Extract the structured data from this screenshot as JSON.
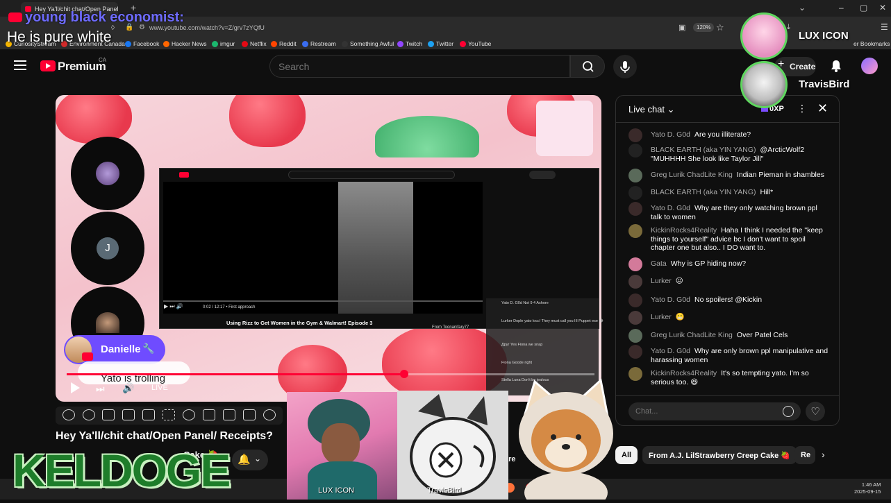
{
  "browser": {
    "tab_title": "Hey Ya'll/chit chat/Open Panel/",
    "url": "www.youtube.com/watch?v=Z/grv7zYQfU",
    "zoom": "120%",
    "bookmarks": [
      {
        "label": "CuriosityStream",
        "color": "#f5b500"
      },
      {
        "label": "Environment Canada",
        "color": "#d12a2a"
      },
      {
        "label": "Facebook",
        "color": "#1877f2"
      },
      {
        "label": "Hacker News",
        "color": "#ff6600"
      },
      {
        "label": "imgur",
        "color": "#1bb76e"
      },
      {
        "label": "Netflix",
        "color": "#e50914"
      },
      {
        "label": "Reddit",
        "color": "#ff4500"
      },
      {
        "label": "Restream",
        "color": "#3a6df0"
      },
      {
        "label": "Something Awful",
        "color": "#333333"
      },
      {
        "label": "Twitch",
        "color": "#9146ff"
      },
      {
        "label": "Twitter",
        "color": "#1da1f2"
      },
      {
        "label": "YouTube",
        "color": "#ff0033"
      }
    ],
    "other_bookmarks": "er Bookmarks"
  },
  "overlay": {
    "chat_author": "young black economist:",
    "chat_message": "He is pure white"
  },
  "header": {
    "brand": "Premium",
    "region": "CA",
    "search_placeholder": "Search",
    "create_label": "Create"
  },
  "video": {
    "inner_title": "Using Rizz to Get Women in the Gym & Walmart! Episode 3",
    "inner_time": "0:02 / 12:17 • First approach",
    "danielle": "Danielle",
    "trolling": "Yato is trolling",
    "live": "LIVE",
    "progress": 0.64,
    "title": "Hey Ya'll/chit chat/Open Panel/ Receipts?",
    "title_fragment": "Cake 🍓",
    "circle_initial": "J",
    "inner_chat": [
      "Yato D. G0d  Not 9 4 Ashore",
      "Lurker  Dople yato locc! They must call you III Puppet ese 😂",
      "Друг  Yes Fiona we snap",
      "Fiona Goode  right",
      "Stella Luna  Don't be jealous"
    ],
    "inner_from": "From Toonanifary77"
  },
  "chat": {
    "title": "Live chat",
    "xp": "0XP",
    "input_placeholder": "Chat...",
    "messages": [
      {
        "author": "Yato D. G0d",
        "text": "Are you illiterate?",
        "color": "#3a2a2a"
      },
      {
        "author": "BLACK EARTH (aka YIN YANG)",
        "text": "@ArcticWolf2 \"MUHHHH She look like Taylor Jill\"",
        "color": "#222"
      },
      {
        "author": "Greg Lurik ChadLite King",
        "text": "Indian Pieman in shambles",
        "color": "#5a6a5a"
      },
      {
        "author": "BLACK EARTH (aka YIN YANG)",
        "text": "Hill*",
        "color": "#222"
      },
      {
        "author": "Yato D. G0d",
        "text": "Why are they only watching brown ppl talk to women",
        "color": "#3a2a2a"
      },
      {
        "author": "KickinRocks4Reality",
        "text": "Haha I think I needed the \"keep things to yourself\" advice bc I don't want to spoil chapter one but also.. I DO want to.",
        "color": "#7a6a3a"
      },
      {
        "author": "Gata",
        "text": "Why is GP hiding now?",
        "color": "#d37a9a"
      },
      {
        "author": "Lurker",
        "text": "😖",
        "color": "#4a3a3a"
      },
      {
        "author": "Yato D. G0d",
        "text": "No spoilers! @Kickin",
        "color": "#3a2a2a"
      },
      {
        "author": "Lurker",
        "text": "😬",
        "color": "#4a3a3a"
      },
      {
        "author": "Greg Lurik ChadLite King",
        "text": "Over Patel Cels",
        "color": "#5a6a5a"
      },
      {
        "author": "Yato D. G0d",
        "text": "Why are only brown ppl manipulative and harassing women",
        "color": "#3a2a2a"
      },
      {
        "author": "KickinRocks4Reality",
        "text": "It's so tempting yato. I'm so serious too. 😆",
        "color": "#7a6a3a"
      }
    ]
  },
  "chips": [
    "All",
    "From A.J. LilStrawberry Creep Cake 🍓",
    "Re"
  ],
  "below_video": {
    "share_fragment": "are"
  },
  "taskbar": {
    "time": "1:46 AM",
    "date": "2025-09-15"
  },
  "streamers": {
    "lux": "LUX ICON",
    "travis": "TravisBird",
    "keldoge": "KELDOGE"
  }
}
